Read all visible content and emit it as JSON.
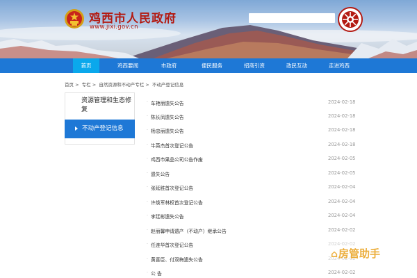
{
  "header": {
    "site_title": "鸡西市人民政府",
    "site_url": "www.jixi.gov.cn",
    "search_placeholder": ""
  },
  "nav": {
    "items": [
      {
        "label": "首页",
        "active": true
      },
      {
        "label": "鸡西要闻",
        "active": false
      },
      {
        "label": "市政府",
        "active": false
      },
      {
        "label": "便民服务",
        "active": false
      },
      {
        "label": "招商引资",
        "active": false
      },
      {
        "label": "政民互动",
        "active": false
      },
      {
        "label": "走进鸡西",
        "active": false
      }
    ]
  },
  "breadcrumb": {
    "items": [
      "首页",
      "专栏",
      "自然资源和不动产专栏",
      "不动产登记信息"
    ],
    "separator": ">"
  },
  "sidebar": {
    "group_label": "资源管理和生态修复",
    "active_item": "不动产登记信息"
  },
  "articles": [
    {
      "title": "车艳丽遗失公告",
      "date": "2024-02-18"
    },
    {
      "title": "陈长凤遗失公告",
      "date": "2024-02-18"
    },
    {
      "title": "杨忠丽遗失公告",
      "date": "2024-02-18"
    },
    {
      "title": "牛英杰首次登记公告",
      "date": "2024-02-18"
    },
    {
      "title": "鸡西市果品公司公告作废",
      "date": "2024-02-05"
    },
    {
      "title": "遗失公告",
      "date": "2024-02-05"
    },
    {
      "title": "张延胜首次登记公告",
      "date": "2024-02-04"
    },
    {
      "title": "许焕军林权首次登记公告",
      "date": "2024-02-04"
    },
    {
      "title": "李廷彬遗失公告",
      "date": "2024-02-04"
    },
    {
      "title": "赵丽馨申请遗产（不动产）继承公告",
      "date": "2024-02-02"
    },
    {
      "title": "任连华首次登记公告",
      "date": "2024-02-02"
    },
    {
      "title": "黄喜臣、付双梅遗失公告",
      "date": "2024-02-02"
    },
    {
      "title": "公 告",
      "date": "2024-02-02"
    }
  ],
  "watermark": {
    "text": "房管助手",
    "icon": "house-icon"
  },
  "colors": {
    "brand_red": "#b31a12",
    "nav_blue": "#1e78d6",
    "nav_active": "#0aa8ec",
    "watermark": "#ecae3c"
  }
}
